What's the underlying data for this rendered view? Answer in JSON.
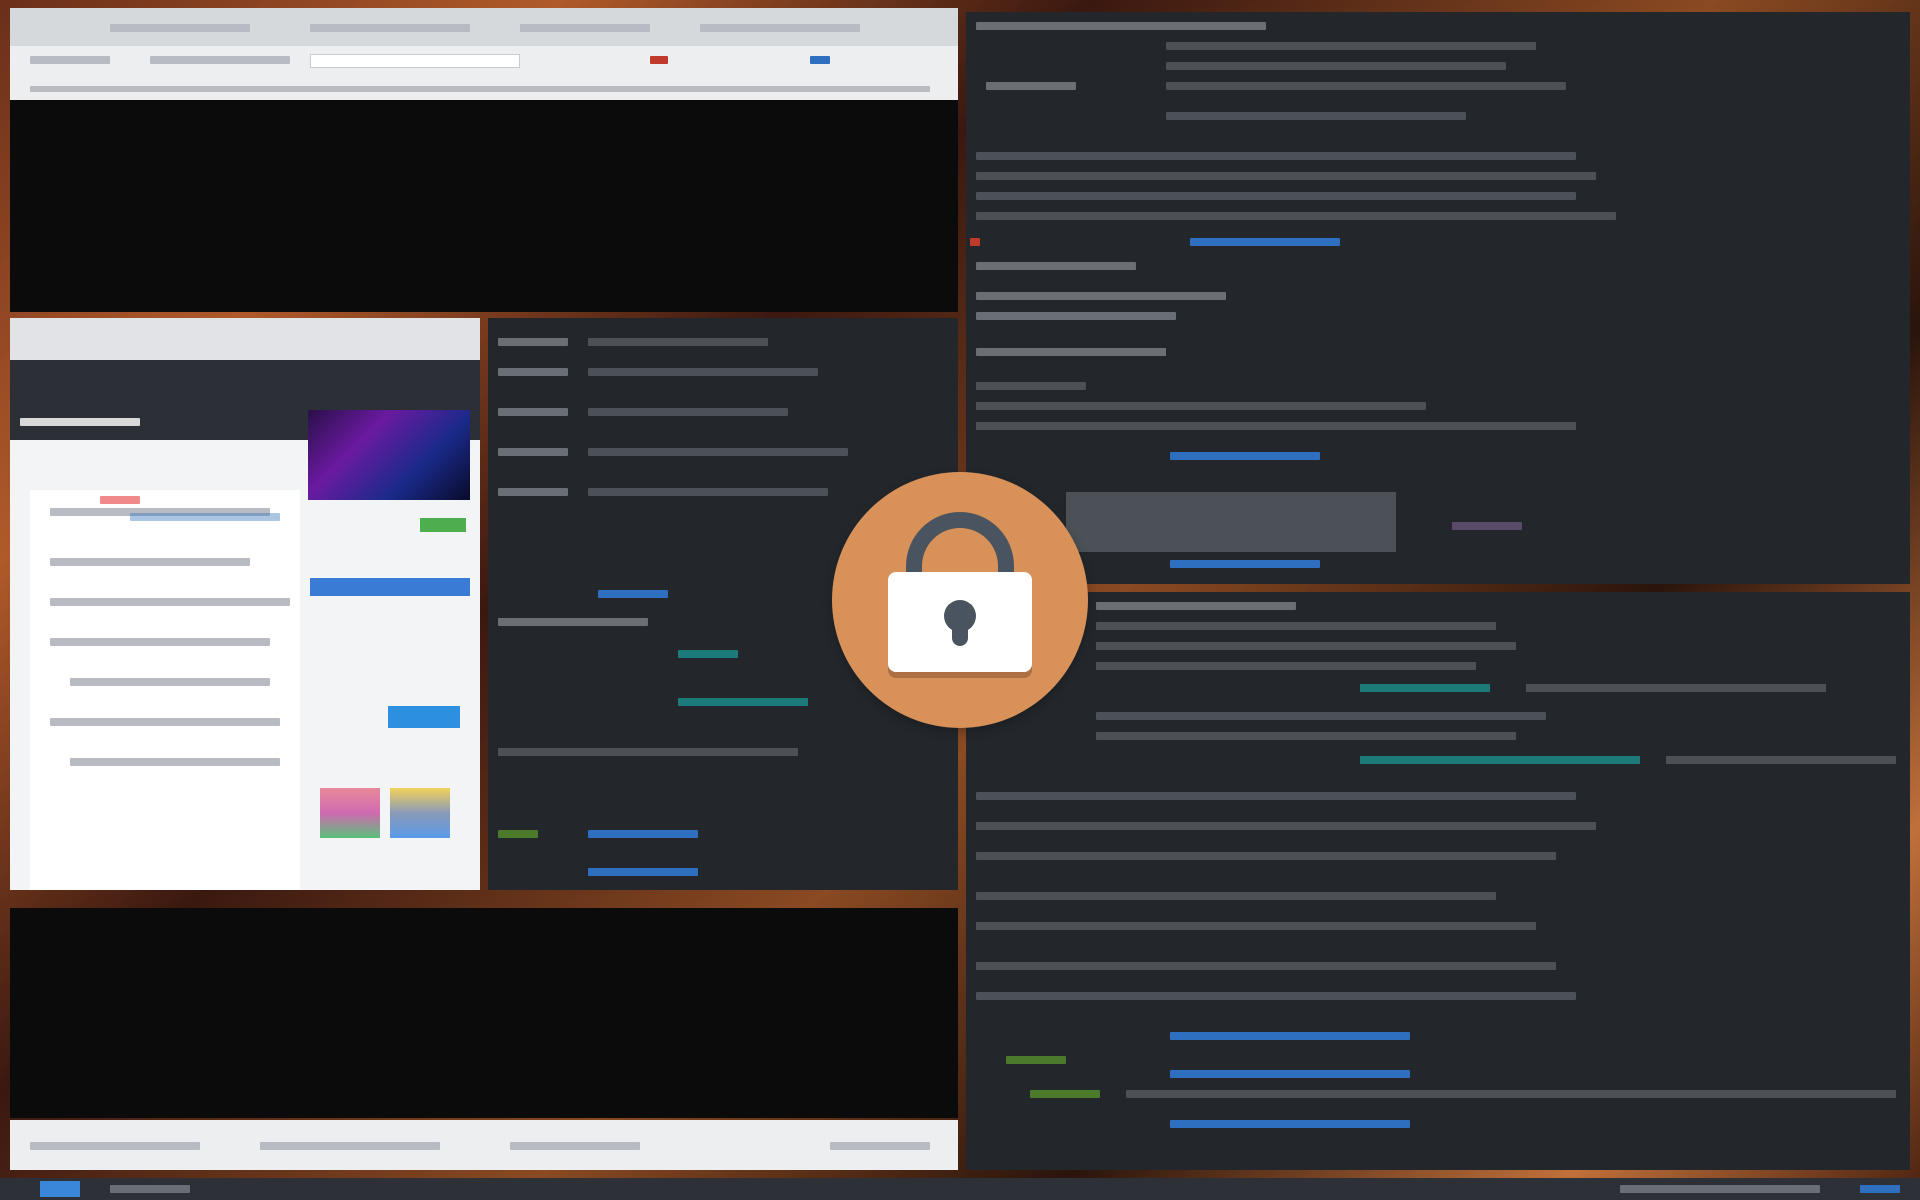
{
  "screen": {
    "state": "locked",
    "lock_icon": "padlock-icon"
  },
  "colors": {
    "lock_circle": "#d9915a",
    "lock_shackle": "#4a5360",
    "lock_body": "#ffffff",
    "terminal_bg": "#23272c",
    "wallpaper": "#7a3e1e"
  },
  "panel": {
    "launcher_icon": "grid-icon"
  }
}
